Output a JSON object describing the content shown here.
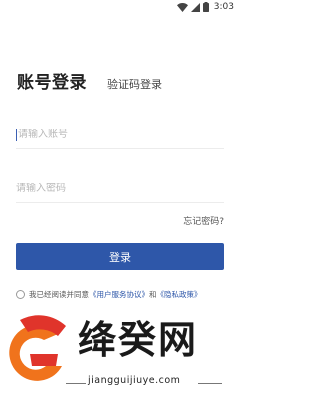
{
  "status_bar": {
    "time": "3:03"
  },
  "tabs": {
    "account_login": "账号登录",
    "code_login": "验证码登录"
  },
  "form": {
    "account_placeholder": "请输入账号",
    "password_placeholder": "请输入密码",
    "forgot_password": "忘记密码?",
    "login_button": "登录"
  },
  "agreement": {
    "prefix": "我已经阅读并同意",
    "user_agreement": "《用户服务协议》",
    "and": "和",
    "privacy_policy": "《隐私政策》"
  },
  "watermark": {
    "brand": "绛癸网",
    "url": "jiangguijiuye.com"
  },
  "colors": {
    "primary": "#2e57a9",
    "watermark_orange": "#f0731c",
    "watermark_red": "#e0342b"
  }
}
